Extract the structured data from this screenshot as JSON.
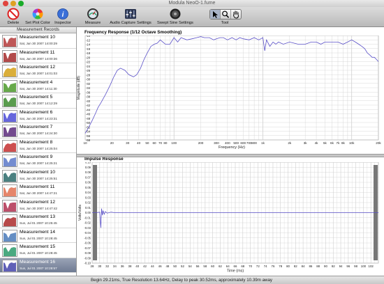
{
  "window": {
    "title": "Modula NeoO-1.fume"
  },
  "toolbar": {
    "delete": "Delete",
    "set_plot_color": "Set Plot Color",
    "inspector": "Inspector",
    "measure": "Measure",
    "audio_capture_settings": "Audio Capture Settings",
    "swept_sine_settings": "Swept Sine Settings",
    "tool": "Tool"
  },
  "sidebar": {
    "header": "Measurement Records",
    "items": [
      {
        "name": "Measurement 10",
        "date": "Sat, Jun 30 2007 14:00:29",
        "color": "#b33a3a"
      },
      {
        "name": "Measurement 11",
        "date": "Sat, Jun 30 2007 14:00:36",
        "color": "#a52a2a"
      },
      {
        "name": "Measurement 12",
        "date": "Sat, Jun 30 2007 14:01:03",
        "color": "#d4a017"
      },
      {
        "name": "Measurement 4",
        "date": "Sat, Jun 30 2007 14:11:30",
        "color": "#4c9a2a"
      },
      {
        "name": "Measurement 5",
        "date": "Sat, Jun 30 2007 14:12:29",
        "color": "#3d8b2f"
      },
      {
        "name": "Measurement 6",
        "date": "Sat, Jun 30 2007 14:23:31",
        "color": "#4b4bd6"
      },
      {
        "name": "Measurement 7",
        "date": "Sat, Jun 30 2007 14:24:30",
        "color": "#5a2a7a"
      },
      {
        "name": "Measurement 8",
        "date": "Sat, Jun 30 2007 14:25:04",
        "color": "#c43030"
      },
      {
        "name": "Measurement 9",
        "date": "Sat, Jun 30 2007 14:25:21",
        "color": "#5a78c8"
      },
      {
        "name": "Measurement 10",
        "date": "Sat, Jun 30 2007 14:25:51",
        "color": "#2a6a6a"
      },
      {
        "name": "Measurement 11",
        "date": "Sat, Jun 30 2007 14:47:21",
        "color": "#e07050"
      },
      {
        "name": "Measurement 12",
        "date": "Sat, Jun 30 2007 14:47:42",
        "color": "#b03050"
      },
      {
        "name": "Measurement 13",
        "date": "Sun, Jul 01 2007 10:25:45",
        "color": "#aa2a2a"
      },
      {
        "name": "Measurement 14",
        "date": "Sun, Jul 01 2007 10:28:45",
        "color": "#4a7ab8"
      },
      {
        "name": "Measurement 15",
        "date": "Sun, Jul 01 2007 10:28:45",
        "color": "#2a9a6a"
      },
      {
        "name": "Measurement 16",
        "date": "Sun, Jul 01 2007 10:28:57",
        "color": "#4444aa"
      }
    ]
  },
  "status": {
    "text": "Begin 29.21ms, True Resolution 13.64Hz, Delay to peak 30.52ms, approximately 10.39m away"
  },
  "colors": {
    "trace": "#5a50c8",
    "grid": "#cfcfcf",
    "selection": "#7d88a0"
  },
  "chart_data": [
    {
      "type": "line",
      "title": "Frequency Response (1/12 Octave Smoothing)",
      "xlabel": "Frequency (Hz)",
      "ylabel": "Magnitude (dB)",
      "xscale": "log",
      "xlim": [
        10,
        20000
      ],
      "ylim": [
        -58,
        -10
      ],
      "xticks": [
        10,
        20,
        30,
        40,
        50,
        60,
        70,
        80,
        100,
        200,
        300,
        400,
        500,
        600,
        700,
        800,
        1000,
        2000,
        3000,
        4000,
        5000,
        6000,
        7000,
        8000,
        10000,
        20000
      ],
      "xtick_labels": [
        "10",
        "20",
        "30",
        "40",
        "50",
        "60",
        "70",
        "80",
        "100",
        "200",
        "300",
        "400",
        "500",
        "600",
        "700",
        "800",
        "1k",
        "2k",
        "3k",
        "4k",
        "5k",
        "6k",
        "7k",
        "8k",
        "10k",
        "20k"
      ],
      "yticks": [
        -10,
        -12,
        -14,
        -16,
        -18,
        -20,
        -22,
        -24,
        -26,
        -28,
        -30,
        -32,
        -34,
        -36,
        -38,
        -40,
        -42,
        -44,
        -46,
        -48,
        -50,
        -52,
        -54,
        -56,
        -58
      ],
      "grid": true,
      "series": [
        {
          "x": [
            10,
            11,
            12,
            13,
            14,
            15,
            17,
            19,
            21,
            23,
            25,
            28,
            31,
            35,
            38,
            42,
            46,
            50,
            55,
            60,
            65,
            70,
            75,
            80,
            90,
            100,
            110,
            120,
            140,
            160,
            180,
            200,
            220,
            250,
            280,
            300,
            330,
            360,
            400,
            450,
            500,
            550,
            600,
            700,
            800,
            900,
            1000,
            1050,
            1100,
            1200,
            1300,
            1400,
            1500,
            1700,
            2000,
            2500,
            3000,
            3500,
            4000,
            4500,
            5000,
            6000,
            7000,
            8000,
            9000,
            10000,
            11000,
            12000,
            13000,
            14000,
            15000,
            16000,
            17000,
            18000,
            19000,
            20000
          ],
          "y": [
            -55,
            -52,
            -49,
            -46,
            -43,
            -41,
            -37,
            -33,
            -29,
            -26,
            -25,
            -26,
            -28,
            -29,
            -28,
            -25,
            -21,
            -18,
            -15,
            -14,
            -13.5,
            -12,
            -13,
            -14,
            -14,
            -11,
            -13,
            -11,
            -12,
            -11.5,
            -11,
            -10.5,
            -11,
            -11,
            -12,
            -11.5,
            -11,
            -11,
            -12,
            -11,
            -12,
            -11,
            -11.5,
            -12,
            -11,
            -12,
            -11,
            -17,
            -12,
            -15,
            -13,
            -14,
            -13,
            -14,
            -13,
            -14,
            -14,
            -13,
            -13,
            -14,
            -13,
            -13,
            -13,
            -14,
            -13,
            -12,
            -13,
            -14,
            -15,
            -16,
            -18,
            -19,
            -20,
            -20,
            -21,
            -22
          ]
        }
      ]
    },
    {
      "type": "line",
      "title": "Impulse Response",
      "xlabel": "Time (ms)",
      "ylabel": "Volts/Volts",
      "xlim": [
        28,
        104
      ],
      "ylim": [
        -0.1,
        0.1
      ],
      "xticks": [
        28,
        30,
        32,
        34,
        36,
        38,
        40,
        42,
        44,
        46,
        48,
        50,
        52,
        54,
        56,
        58,
        60,
        62,
        64,
        66,
        68,
        70,
        72,
        74,
        76,
        78,
        80,
        82,
        84,
        86,
        88,
        90,
        92,
        94,
        96,
        98,
        100,
        102
      ],
      "yticks": [
        0.1,
        0.09,
        0.08,
        0.07,
        0.06,
        0.05,
        0.04,
        0.03,
        0.02,
        0.01,
        0.0,
        -0.01,
        -0.02,
        -0.03,
        -0.04,
        -0.05,
        -0.06,
        -0.07,
        -0.08,
        -0.09,
        -0.1
      ],
      "ytick_labels": [
        "0.10",
        "0.09",
        "0.08",
        "0.07",
        "0.06",
        "0.05",
        "0.04",
        "0.03",
        "0.02",
        "0.01",
        "0.00",
        "-0.01",
        "-0.02",
        "-0.03",
        "-0.04",
        "-0.05",
        "-0.06",
        "-0.07",
        "-0.08",
        "-0.09",
        "-0.10"
      ],
      "grid": true,
      "series": [
        {
          "x": [
            28,
            29,
            30,
            30.3,
            30.5,
            30.7,
            30.9,
            31.2,
            31.5,
            32,
            33,
            34,
            36,
            40,
            50,
            60,
            70,
            80,
            90,
            100,
            104
          ],
          "y": [
            0,
            0,
            0.001,
            -0.03,
            0.008,
            -0.005,
            0.004,
            -0.003,
            0.002,
            -0.001,
            0.001,
            0,
            0,
            0,
            0,
            0,
            0,
            0,
            0,
            0,
            0
          ]
        }
      ]
    }
  ]
}
